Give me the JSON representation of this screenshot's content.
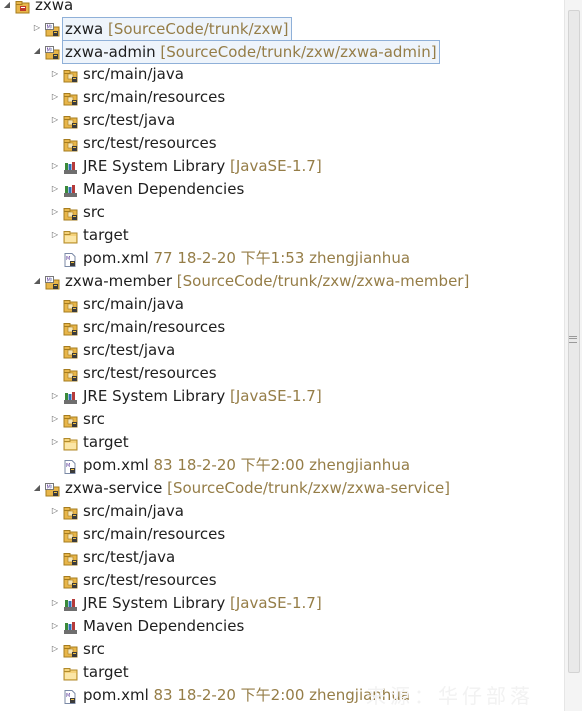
{
  "tree": [
    {
      "level": 0,
      "toggle": "expanded",
      "icon": "project-folder-icon",
      "label": "zxwa",
      "decoration": "",
      "selected": false
    },
    {
      "level": 1,
      "toggle": "collapsed",
      "icon": "maven-project-icon",
      "label": "zxwa",
      "decoration": "[SourceCode/trunk/zxw]",
      "selected": true
    },
    {
      "level": 1,
      "toggle": "expanded",
      "icon": "maven-project-icon",
      "label": "zxwa-admin",
      "decoration": "[SourceCode/trunk/zxw/zxwa-admin]",
      "selected": true
    },
    {
      "level": 2,
      "toggle": "collapsed",
      "icon": "source-folder-icon",
      "label": "src/main/java",
      "decoration": "",
      "selected": false
    },
    {
      "level": 2,
      "toggle": "collapsed",
      "icon": "source-folder-icon",
      "label": "src/main/resources",
      "decoration": "",
      "selected": false
    },
    {
      "level": 2,
      "toggle": "collapsed",
      "icon": "source-folder-icon",
      "label": "src/test/java",
      "decoration": "",
      "selected": false
    },
    {
      "level": 2,
      "toggle": "none",
      "icon": "source-folder-icon",
      "label": "src/test/resources",
      "decoration": "",
      "selected": false
    },
    {
      "level": 2,
      "toggle": "collapsed",
      "icon": "library-icon",
      "label": "JRE System Library",
      "decoration": "[JavaSE-1.7]",
      "selected": false
    },
    {
      "level": 2,
      "toggle": "collapsed",
      "icon": "library-icon",
      "label": "Maven Dependencies",
      "decoration": "",
      "selected": false
    },
    {
      "level": 2,
      "toggle": "collapsed",
      "icon": "source-folder-icon",
      "label": "src",
      "decoration": "",
      "selected": false
    },
    {
      "level": 2,
      "toggle": "collapsed",
      "icon": "folder-icon",
      "label": "target",
      "decoration": "",
      "selected": false
    },
    {
      "level": 2,
      "toggle": "none",
      "icon": "xml-file-icon",
      "label": "pom.xml",
      "decoration": "77  18-2-20 下午1:53  zhengjianhua",
      "selected": false
    },
    {
      "level": 1,
      "toggle": "expanded",
      "icon": "maven-project-icon",
      "label": "zxwa-member",
      "decoration": "[SourceCode/trunk/zxw/zxwa-member]",
      "selected": false
    },
    {
      "level": 2,
      "toggle": "none",
      "icon": "source-folder-icon",
      "label": "src/main/java",
      "decoration": "",
      "selected": false
    },
    {
      "level": 2,
      "toggle": "none",
      "icon": "source-folder-icon",
      "label": "src/main/resources",
      "decoration": "",
      "selected": false
    },
    {
      "level": 2,
      "toggle": "none",
      "icon": "source-folder-icon",
      "label": "src/test/java",
      "decoration": "",
      "selected": false
    },
    {
      "level": 2,
      "toggle": "none",
      "icon": "source-folder-icon",
      "label": "src/test/resources",
      "decoration": "",
      "selected": false
    },
    {
      "level": 2,
      "toggle": "collapsed",
      "icon": "library-icon",
      "label": "JRE System Library",
      "decoration": "[JavaSE-1.7]",
      "selected": false
    },
    {
      "level": 2,
      "toggle": "collapsed",
      "icon": "source-folder-icon",
      "label": "src",
      "decoration": "",
      "selected": false
    },
    {
      "level": 2,
      "toggle": "collapsed",
      "icon": "folder-icon",
      "label": "target",
      "decoration": "",
      "selected": false
    },
    {
      "level": 2,
      "toggle": "none",
      "icon": "xml-file-icon",
      "label": "pom.xml",
      "decoration": "83  18-2-20 下午2:00  zhengjianhua",
      "selected": false
    },
    {
      "level": 1,
      "toggle": "expanded",
      "icon": "maven-project-icon",
      "label": "zxwa-service",
      "decoration": "[SourceCode/trunk/zxw/zxwa-service]",
      "selected": false
    },
    {
      "level": 2,
      "toggle": "collapsed",
      "icon": "source-folder-icon",
      "label": "src/main/java",
      "decoration": "",
      "selected": false
    },
    {
      "level": 2,
      "toggle": "none",
      "icon": "source-folder-icon",
      "label": "src/main/resources",
      "decoration": "",
      "selected": false
    },
    {
      "level": 2,
      "toggle": "none",
      "icon": "source-folder-icon",
      "label": "src/test/java",
      "decoration": "",
      "selected": false
    },
    {
      "level": 2,
      "toggle": "none",
      "icon": "source-folder-icon",
      "label": "src/test/resources",
      "decoration": "",
      "selected": false
    },
    {
      "level": 2,
      "toggle": "collapsed",
      "icon": "library-icon",
      "label": "JRE System Library",
      "decoration": "[JavaSE-1.7]",
      "selected": false
    },
    {
      "level": 2,
      "toggle": "collapsed",
      "icon": "library-icon",
      "label": "Maven Dependencies",
      "decoration": "",
      "selected": false
    },
    {
      "level": 2,
      "toggle": "collapsed",
      "icon": "source-folder-icon",
      "label": "src",
      "decoration": "",
      "selected": false
    },
    {
      "level": 2,
      "toggle": "none",
      "icon": "folder-icon",
      "label": "target",
      "decoration": "",
      "selected": false
    },
    {
      "level": 2,
      "toggle": "none",
      "icon": "xml-file-icon",
      "label": "pom.xml",
      "decoration": "83  18-2-20 下午2:00  zhengjianhua",
      "selected": false
    }
  ],
  "watermark": "来源：华仔部落",
  "colors": {
    "decoration": "#957d47",
    "selection_border": "#8fb0d8",
    "folder": "#e8b64a"
  }
}
